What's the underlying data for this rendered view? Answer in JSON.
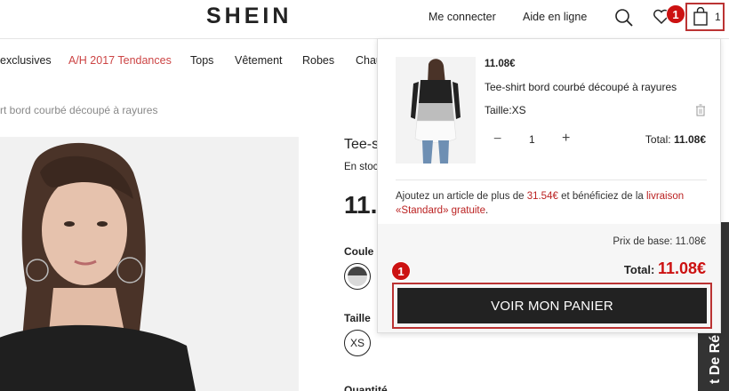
{
  "header": {
    "logo": "SHEIN",
    "login": "Me connecter",
    "help": "Aide en ligne",
    "cart_count": "1",
    "wishlist_badge": "1"
  },
  "nav": {
    "items": [
      "exclusives",
      "A/H 2017 Tendances",
      "Tops",
      "Vêtement",
      "Robes",
      "Chau"
    ]
  },
  "breadcrumb": "rt bord courbé découpé à rayures",
  "product": {
    "title": "Tee-s",
    "stock": "En stoc",
    "price": "11.",
    "color_label": "Coule",
    "size_label": "Taille",
    "size_value": "XS",
    "qty_label": "Quantité"
  },
  "side_tab": "t De Ré",
  "cart": {
    "item_price": "11.08€",
    "item_name": "Tee-shirt bord courbé découpé à rayures",
    "item_size": "Taille:XS",
    "minus": "−",
    "qty": "1",
    "plus": "+",
    "total_label": "Total:",
    "total_value": "11.08€",
    "promo_before": "Ajoutez un article de plus de ",
    "promo_amount": "31.54€",
    "promo_middle": " et bénéficiez de la ",
    "promo_link": "livraison «Standard» gratuite",
    "promo_end": ".",
    "base_price": "Prix de base: 11.08€",
    "grand_label": "Total: ",
    "grand_value": "11.08€",
    "checkout_button": "VOIR MON PANIER",
    "step_badge": "1"
  },
  "colors": {
    "accent": "#cc1111",
    "button": "#222222",
    "highlight_border": "#bb3333"
  }
}
